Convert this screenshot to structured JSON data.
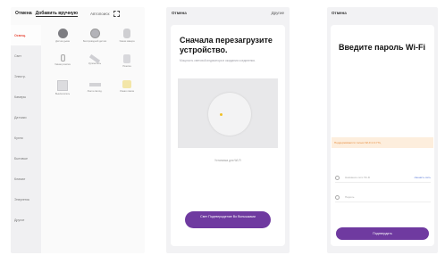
{
  "screen1": {
    "cancel": "Отмена",
    "add_manual": "Добавить вручную",
    "auto_search": "Автопоиск",
    "categories": [
      "Освещ.",
      "Свет",
      "Электр.",
      "Камеры",
      "Датчики",
      "Кухня",
      "Бытовые",
      "Климат",
      "Энергетик",
      "Другое"
    ],
    "devices": [
      {
        "label": "Датчик дыма",
        "icon": "smoke-sensor-icon",
        "style": "round-dark"
      },
      {
        "label": "Беспроводной датчик",
        "icon": "round-sensor-icon",
        "style": "round-gray"
      },
      {
        "label": "Умная камера",
        "icon": "camera-icon",
        "style": "cam"
      },
      {
        "label": "Умная розетка",
        "icon": "plug-icon",
        "style": "plug"
      },
      {
        "label": "Удлинитель",
        "icon": "power-strip-icon",
        "style": "strip"
      },
      {
        "label": "Розетка",
        "icon": "outlet-icon",
        "style": "outlet"
      },
      {
        "label": "Выключатель",
        "icon": "wall-switch-icon",
        "style": "square"
      },
      {
        "label": "Лента светод.",
        "icon": "led-strip-icon",
        "style": "slim"
      },
      {
        "label": "Умная лампа",
        "icon": "bulb-icon",
        "style": "yellow"
      }
    ]
  },
  "screen2": {
    "cancel": "Отмена",
    "other": "Другие",
    "title": "Сначала перезагрузите устройство.",
    "subtitle": "Мощность световой индикатора в ожидании соединения.",
    "link": "Установка для Wi-Fi",
    "button": "Свет Подтверждение Во Вспышками"
  },
  "screen3": {
    "cancel": "Отмена",
    "title": "Введите пароль Wi-Fi",
    "warning": "Поддерживается только Wi-Fi 2.4 ГГц",
    "ssid_placeholder": "Название сети Wi-Fi",
    "change": "сменить сеть",
    "password_placeholder": "Пароль",
    "confirm": "Подтвердить"
  },
  "colors": {
    "accent_purple": "#6f3aa0",
    "accent_red": "#e84a3a",
    "warning_bg": "#fdeedd",
    "warning_text": "#e68a3a"
  }
}
